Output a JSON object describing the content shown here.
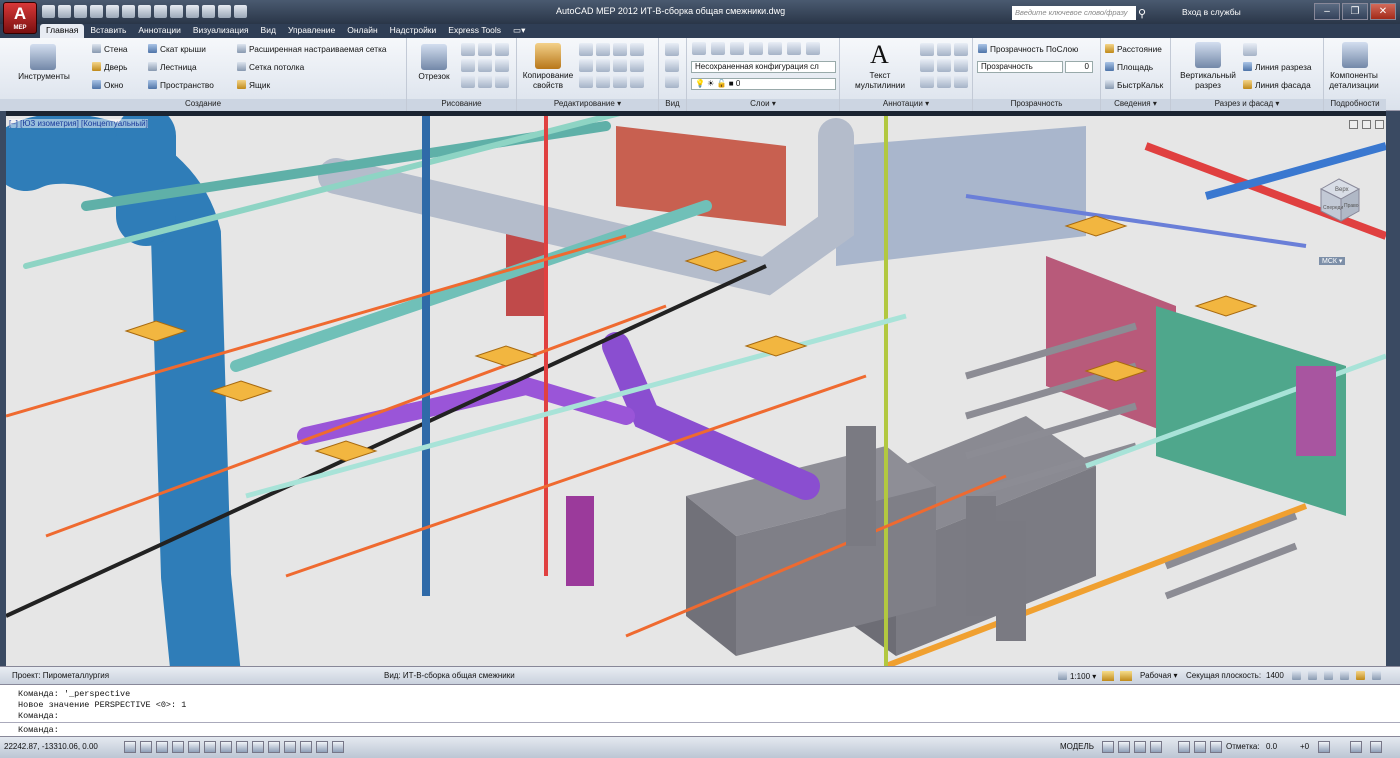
{
  "app": {
    "icon_caption": "MEP",
    "title_text": "AutoCAD MEP 2012     ИТ-В-сборка общая смежники.dwg",
    "search_placeholder": "Введите ключевое слово/фразу",
    "login": "Вход в службы",
    "window_buttons": [
      "–",
      "❐",
      "✕"
    ]
  },
  "tabs": [
    "Главная",
    "Вставить",
    "Аннотации",
    "Визуализация",
    "Вид",
    "Управление",
    "Онлайн",
    "Надстройки",
    "Express Tools"
  ],
  "active_tab": "Главная",
  "ribbon": {
    "panels": [
      {
        "key": "create",
        "title": "Создание"
      },
      {
        "key": "draw",
        "title": "Рисование"
      },
      {
        "key": "modify",
        "title": "Редактирование ▾"
      },
      {
        "key": "view",
        "title": "Вид"
      },
      {
        "key": "layers",
        "title": "Слои ▾"
      },
      {
        "key": "annotations",
        "title": "Аннотации ▾"
      },
      {
        "key": "transparency",
        "title": "Прозрачность"
      },
      {
        "key": "info",
        "title": "Сведения ▾"
      },
      {
        "key": "section",
        "title": "Разрез и фасад ▾"
      },
      {
        "key": "details",
        "title": "Подробности"
      }
    ],
    "create": {
      "tools": "Инструменты",
      "items": [
        "Стена",
        "Дверь",
        "Окно",
        "Скат крыши",
        "Лестница",
        "Пространство",
        "Расширенная настраиваемая сетка",
        "Сетка потолка",
        "Ящик"
      ]
    },
    "draw": {
      "segment": "Отрезок"
    },
    "modify": {
      "copy_props": "Копирование свойств"
    },
    "layers": {
      "config": "Несохраненная конфигурация сл",
      "current": "0"
    },
    "annotations": {
      "text": "Текст мультилинии"
    },
    "transparency": {
      "bylayer": "Прозрачность ПоСлою",
      "label": "Прозрачность",
      "value": "0"
    },
    "info": {
      "items": [
        "Расстояние",
        "Площадь",
        "БыстрКальк"
      ]
    },
    "section": {
      "vertical": "Вертикальный разрез",
      "items": [
        "Линия разреза",
        "Линия фасада"
      ]
    },
    "details": {
      "components": "Компоненты детализации"
    }
  },
  "viewport": {
    "label": "[–] [ЮЗ изометрия] [Концептуальный]",
    "viewcube": {
      "top": "Верх",
      "front": "Спереди",
      "right": "Право"
    },
    "ucs": "МСК ▾"
  },
  "status": {
    "project": "Проект: Пирометаллургия",
    "view": "Вид: ИТ-В-сборка общая смежники",
    "scale": "1:100 ▾",
    "workspace": "Рабочая ▾",
    "section_plane": "Секущая плоскость:",
    "section_value": "1400"
  },
  "command": {
    "lines": [
      "Команда: '_perspective",
      "Новое значение PERSPECTIVE <0>: 1",
      "Команда:"
    ],
    "prompt": "Команда:"
  },
  "bottom": {
    "coords": "22242.87, -13310.06, 0.00",
    "model": "МОДЕЛЬ",
    "elevation_label": "Отметка:",
    "elevation_value": "0.0",
    "offset": "+0"
  }
}
